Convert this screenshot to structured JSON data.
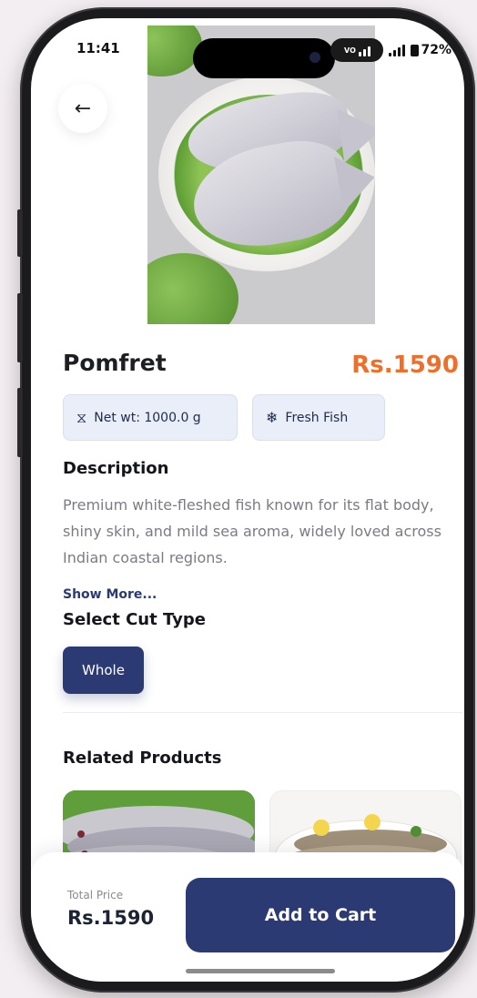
{
  "status_bar": {
    "time": "11:41",
    "battery": "72%",
    "badge_text": "VO"
  },
  "product": {
    "name": "Pomfret",
    "price": "Rs.1590",
    "chips": [
      {
        "icon": "scale-icon",
        "glyph": "⧖",
        "label": "Net wt: 1000.0 g"
      },
      {
        "icon": "snowflake-icon",
        "glyph": "❄",
        "label": "Fresh Fish"
      }
    ]
  },
  "description": {
    "title": "Description",
    "text": "Premium white-fleshed fish known for its flat body, shiny skin, and mild sea aroma, widely loved across Indian coastal regions.",
    "show_more": "Show More..."
  },
  "cut_type": {
    "title": "Select Cut Type",
    "selected": "Whole"
  },
  "related": {
    "title": "Related Products"
  },
  "checkout": {
    "total_label": "Total Price",
    "total_value": "Rs.1590",
    "button_label": "Add to Cart"
  },
  "colors": {
    "primary": "#2b3a72",
    "price_accent": "#f06f28"
  }
}
